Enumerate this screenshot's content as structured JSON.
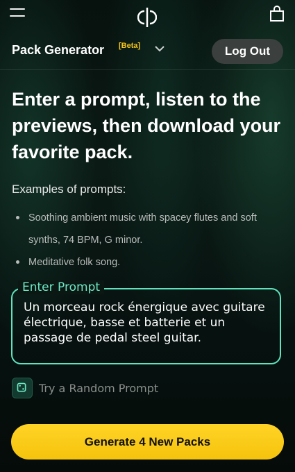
{
  "header": {
    "menu_icon": "hamburger-menu-icon",
    "logo_icon": "brand-logo-icon",
    "bag_icon": "shopping-bag-icon"
  },
  "subheader": {
    "title": "Pack Generator",
    "badge": "[Beta]",
    "chevron_icon": "chevron-down-icon",
    "logout_label": "Log Out"
  },
  "main": {
    "headline": "Enter a prompt, listen to the previews, then download your favorite pack.",
    "examples_heading": "Examples of prompts:",
    "examples": [
      "Soothing ambient music with spacey flutes and soft synths, 74 BPM, G minor.",
      "Meditative folk song."
    ],
    "prompt_label": "Enter Prompt",
    "prompt_value": "Un morceau rock énergique avec guitare électrique, basse et batterie et un passage de pedal steel guitar.",
    "random_icon": "dice-icon",
    "random_label": "Try a Random Prompt",
    "generate_label": "Generate 4 New Packs"
  },
  "colors": {
    "accent": "#5fe3bd",
    "primary_button": "#ffd326",
    "badge": "#f5c518",
    "background": "#07110e"
  }
}
